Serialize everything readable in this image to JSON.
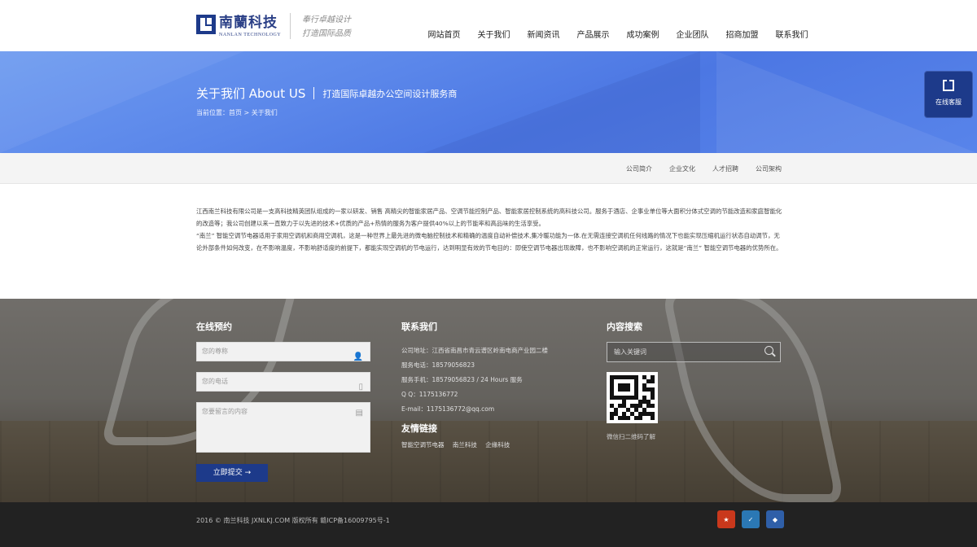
{
  "header": {
    "logo_cn": "南蘭科技",
    "logo_en": "NANLAN TECHNOLOGY",
    "slogan_line1": "奉行卓越设计",
    "slogan_line2": "打造国际品质",
    "nav": [
      "网站首页",
      "关于我们",
      "新闻资讯",
      "产品展示",
      "成功案例",
      "企业团队",
      "招商加盟",
      "联系我们"
    ]
  },
  "banner": {
    "title": "关于我们 About US",
    "subtitle": "打造国际卓越办公空间设计服务商",
    "breadcrumb": "当前位置：首页 > 关于我们"
  },
  "service": {
    "label": "在线客服",
    "icon": "logo-icon"
  },
  "subnav": [
    "公司简介",
    "企业文化",
    "人才招聘",
    "公司架构"
  ],
  "content": {
    "paragraph1": "江西南兰科技有限公司是一支高科技精英团队组成的一家以研发、销售 高精尖的智能家居产品、空调节能控制产品、智能家居控制系统的高科技公司。服务于酒店、企事业单位等大面积分体式空调的节能改造和家庭智能化的改造等；我公司创建以来一直致力于以先进的技术+优质的产品+热情的服务为客户提供40%以上的节能率和高品味的生活享受。",
    "paragraph2": "“南兰” 智能空调节电器适用于家用空调机和商用空调机，这是一种世界上最先进的微电脑控制技术和精确的温度自动补偿技术,集冷暖功能为一体.在无需连接空调机任何线路的情况下也能实现压缩机运行状态自动调节，无论外部条件如何改变，在不影响温度，不影响舒适度的前提下，都能实现空调机的节电运行，达到明显有效的节电目的：即使空调节电器出现故障，也不影响空调机的正常运行，这就是“南兰” 智能空调节电器的优势所在。"
  },
  "footer": {
    "booking_title": "在线预约",
    "name_placeholder": "您的尊称",
    "phone_placeholder": "您的电话",
    "message_placeholder": "您要留言的内容",
    "submit_label": "立即提交 →",
    "contact_title": "联系我们",
    "contact_lines": [
      "公司地址：江西省南昌市青云谱区岭南电商产业园二楼",
      "服务电话：18579056823",
      "服务手机：18579056823 / 24 Hours 服务",
      "Q     Q：1175136772",
      "E-mail：1175136772@qq.com"
    ],
    "links_title": "友情链接",
    "links": [
      "智能空调节电器",
      "南兰科技",
      "企缘科技"
    ],
    "search_title": "内容搜索",
    "search_placeholder": "输入关键词",
    "qr_caption": "微信扫二维码了解"
  },
  "bottom": {
    "copyright": "2016 © 南兰科技 JXNLKJ.COM 版权所有 赣ICP备16009795号-1",
    "badge_colors": [
      "#c9381c",
      "#2b78b4",
      "#2f5fa8"
    ]
  }
}
